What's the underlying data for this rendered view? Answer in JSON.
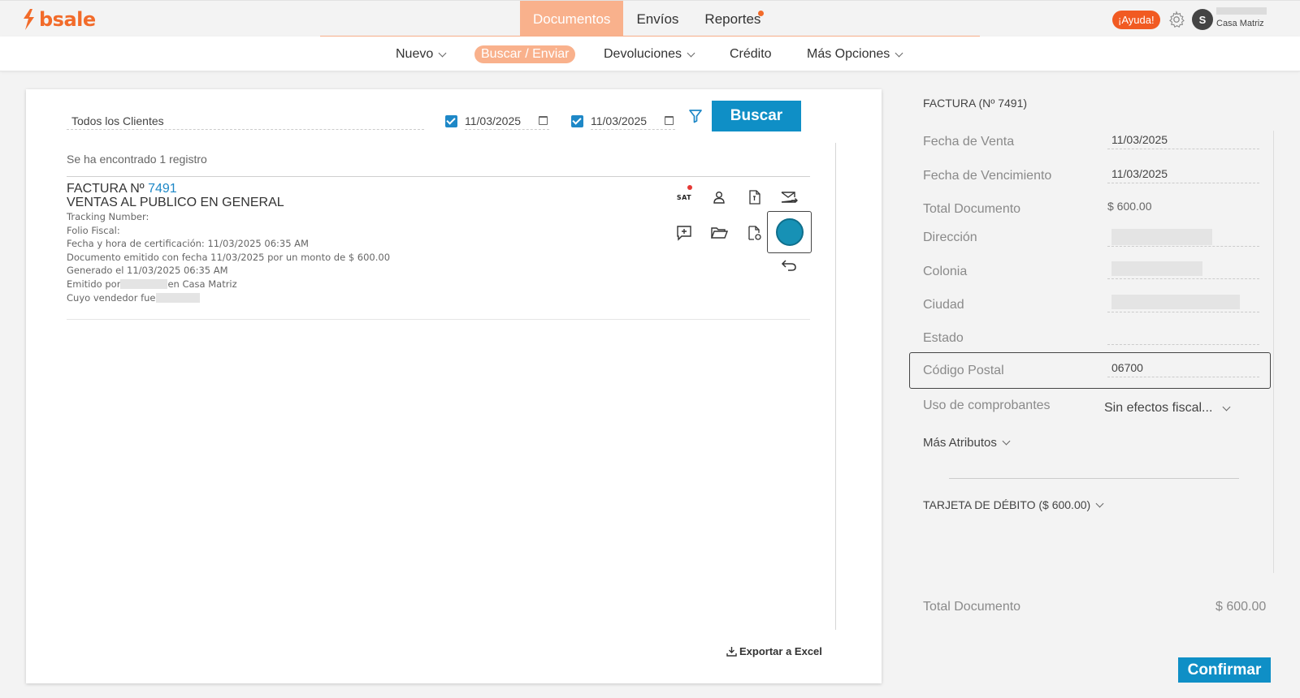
{
  "brand": {
    "name": "bsale",
    "color": "#f26b2a"
  },
  "topnav": {
    "tabs": [
      {
        "label": "Documentos",
        "active": true
      },
      {
        "label": "Envíos"
      },
      {
        "label": "Reportes",
        "badge": true
      }
    ],
    "help_label": "¡Ayuda!",
    "avatar_initial": "S",
    "branch": "Casa Matriz"
  },
  "subnav": {
    "items": [
      "Nuevo",
      "Buscar / Enviar",
      "Devoluciones",
      "Crédito",
      "Más Opciones"
    ]
  },
  "search": {
    "client_value": "Todos los Clientes",
    "date_from": "11/03/2025",
    "date_to": "11/03/2025",
    "button_label": "Buscar"
  },
  "results": {
    "summary": "Se ha encontrado 1 registro",
    "document": {
      "title_prefix": "FACTURA Nº",
      "number": "7491",
      "client": "VENTAS AL PUBLICO EN GENERAL",
      "tracking": "Tracking Number:",
      "folio": "Folio Fiscal:",
      "certification": "Fecha y hora de certificación: 11/03/2025 06:35 AM",
      "emitted_detail": "Documento emitido con fecha 11/03/2025 por un monto de $ 600.00",
      "generated": "Generado el 11/03/2025 06:35 AM",
      "emitted_by_prefix": "Emitido por",
      "emitted_by_suffix": "en Casa Matriz",
      "seller_prefix": "Cuyo vendedor fue"
    },
    "export_label": "Exportar a Excel",
    "sat_label": "SAT"
  },
  "detail": {
    "title": "FACTURA (Nº 7491)",
    "fields": {
      "fecha_venta": {
        "label": "Fecha de Venta",
        "value": "11/03/2025"
      },
      "fecha_vencimiento": {
        "label": "Fecha de Vencimiento",
        "value": "11/03/2025"
      },
      "total": {
        "label": "Total Documento",
        "value": "$ 600.00"
      },
      "direccion": {
        "label": "Dirección"
      },
      "colonia": {
        "label": "Colonia"
      },
      "ciudad": {
        "label": "Ciudad"
      },
      "estado": {
        "label": "Estado",
        "value": ""
      },
      "codigo_postal": {
        "label": "Código Postal",
        "value": "06700"
      },
      "uso": {
        "label": "Uso de comprobantes",
        "value": "Sin efectos fiscal..."
      }
    },
    "more_attributes": "Más Atributos",
    "payment": "TARJETA DE DÉBITO ($ 600.00)",
    "total_label": "Total Documento",
    "total_value": "$ 600.00",
    "confirm_label": "Confirmar"
  },
  "colors": {
    "accent": "#0f8fc6",
    "orange": "#f9b18c",
    "badge": "#f15a22"
  }
}
